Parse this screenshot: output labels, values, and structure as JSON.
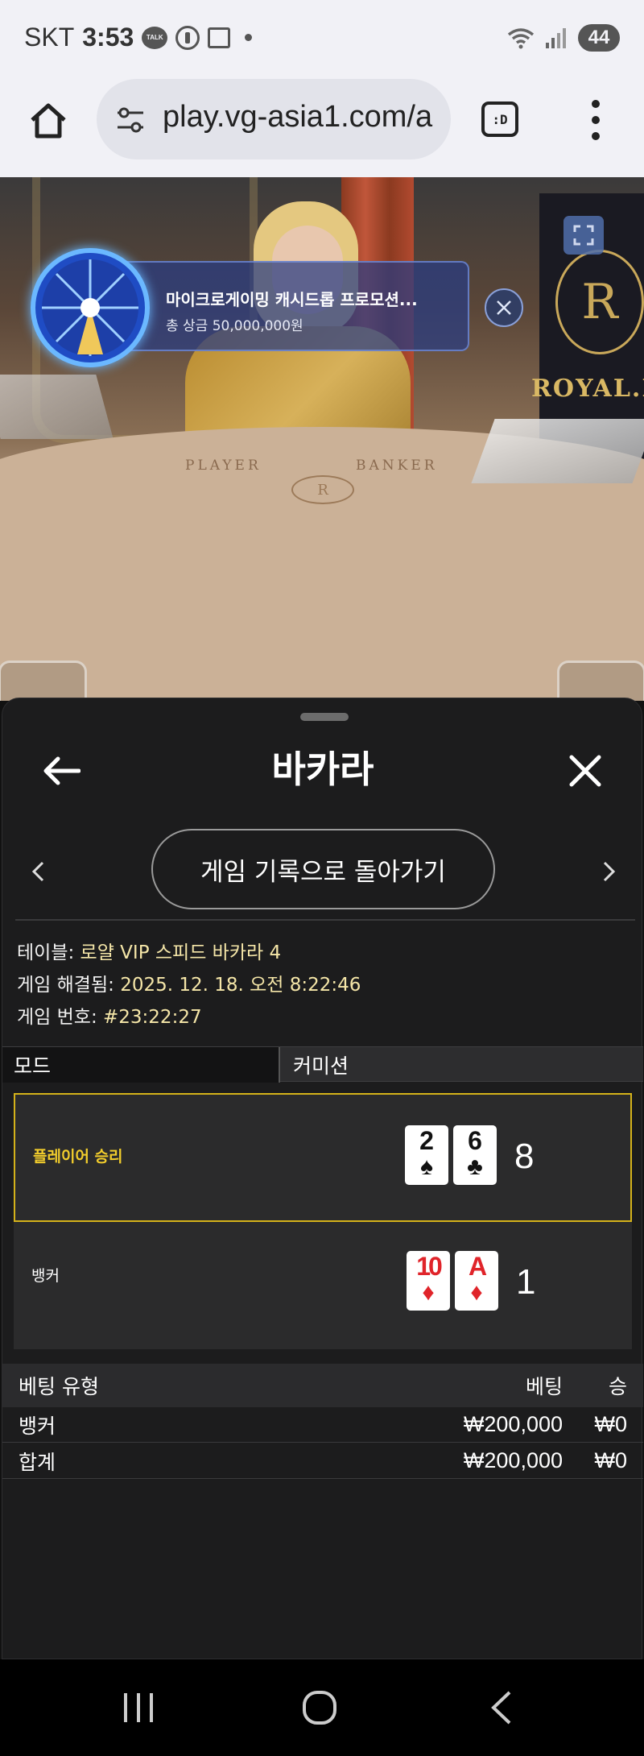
{
  "status_bar": {
    "carrier": "SKT",
    "time": "3:53",
    "talk_icon_text": "TALK",
    "battery": "44"
  },
  "browser": {
    "url": "play.vg-asia1.com/a",
    "tab_label": ":D"
  },
  "video": {
    "promo_title": "마이크로게이밍 캐시드롭 프로모션...",
    "promo_prize": "총 상금 50,000,000원",
    "table_player_label": "PLAYER",
    "table_banker_label": "BANKER",
    "table_logo": "R",
    "brand_emblem": "R",
    "brand_text": "ROYAL.I"
  },
  "panel": {
    "title": "바카라",
    "history_button": "게임 기록으로 돌아가기",
    "info": {
      "table_label": "테이블:",
      "table_value": "로얄 VIP 스피드 바카라 4",
      "settled_label": "게임 해결됨:",
      "settled_value": "2025. 12. 18. 오전 8:22:46",
      "game_no_label": "게임 번호:",
      "game_no_value": "#23:22:27"
    },
    "mode": {
      "col1": "모드",
      "col2": "커미션"
    },
    "results": {
      "player": {
        "label": "플레이어 승리",
        "cards": [
          {
            "rank": "2",
            "suit": "♠",
            "color": "#111111"
          },
          {
            "rank": "6",
            "suit": "♣",
            "color": "#111111"
          }
        ],
        "score": "8"
      },
      "banker": {
        "label": "뱅커",
        "cards": [
          {
            "rank": "10",
            "suit": "♦",
            "color": "#e0242a"
          },
          {
            "rank": "A",
            "suit": "♦",
            "color": "#e0242a"
          }
        ],
        "score": "1"
      }
    },
    "bets": {
      "headers": {
        "type": "베팅 유형",
        "bet": "베팅",
        "win": "승"
      },
      "rows": [
        {
          "type": "뱅커",
          "bet": "₩200,000",
          "win": "₩0"
        },
        {
          "type": "합계",
          "bet": "₩200,000",
          "win": "₩0"
        }
      ]
    }
  },
  "colors": {
    "accent_yellow": "#f2cd2c",
    "info_value": "#f5e6a8",
    "panel_bg": "#1c1c1d"
  },
  "icons": {
    "home": "home-icon",
    "tune": "site-settings-icon",
    "menu": "more-vert-icon",
    "back": "arrow-left-icon",
    "close": "close-icon",
    "prev": "chevron-left-icon",
    "next": "chevron-right-icon",
    "expand": "expand-icon"
  }
}
